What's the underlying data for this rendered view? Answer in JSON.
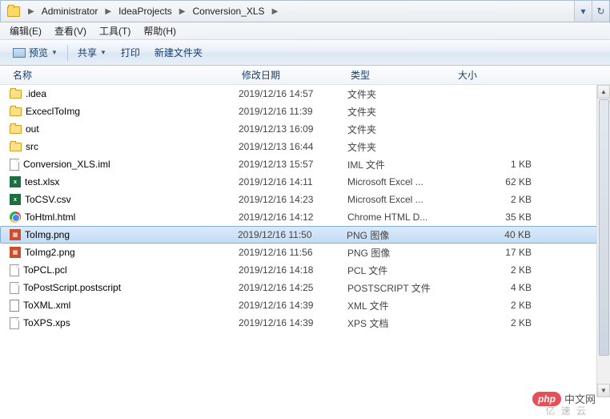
{
  "breadcrumb": [
    "Administrator",
    "IdeaProjects",
    "Conversion_XLS"
  ],
  "menu": {
    "edit": "编辑(E)",
    "view": "查看(V)",
    "tools": "工具(T)",
    "help": "帮助(H)"
  },
  "toolbar": {
    "preview": "预览",
    "share": "共享",
    "print": "打印",
    "newfolder": "新建文件夹"
  },
  "columns": {
    "name": "名称",
    "date": "修改日期",
    "type": "类型",
    "size": "大小"
  },
  "files": [
    {
      "icon": "folder",
      "name": ".idea",
      "date": "2019/12/16 14:57",
      "type": "文件夹",
      "size": ""
    },
    {
      "icon": "folder",
      "name": "ExceclToImg",
      "date": "2019/12/16 11:39",
      "type": "文件夹",
      "size": ""
    },
    {
      "icon": "folder",
      "name": "out",
      "date": "2019/12/13 16:09",
      "type": "文件夹",
      "size": ""
    },
    {
      "icon": "folder",
      "name": "src",
      "date": "2019/12/13 16:44",
      "type": "文件夹",
      "size": ""
    },
    {
      "icon": "file",
      "name": "Conversion_XLS.iml",
      "date": "2019/12/13 15:57",
      "type": "IML 文件",
      "size": "1 KB"
    },
    {
      "icon": "xls",
      "name": "test.xlsx",
      "date": "2019/12/16 14:11",
      "type": "Microsoft Excel ...",
      "size": "62 KB"
    },
    {
      "icon": "xls",
      "name": "ToCSV.csv",
      "date": "2019/12/16 14:23",
      "type": "Microsoft Excel ...",
      "size": "2 KB"
    },
    {
      "icon": "chrome",
      "name": "ToHtml.html",
      "date": "2019/12/16 14:12",
      "type": "Chrome HTML D...",
      "size": "35 KB"
    },
    {
      "icon": "png",
      "name": "ToImg.png",
      "date": "2019/12/16 11:50",
      "type": "PNG 图像",
      "size": "40 KB",
      "selected": true
    },
    {
      "icon": "png",
      "name": "ToImg2.png",
      "date": "2019/12/16 11:56",
      "type": "PNG 图像",
      "size": "17 KB"
    },
    {
      "icon": "file",
      "name": "ToPCL.pcl",
      "date": "2019/12/16 14:18",
      "type": "PCL 文件",
      "size": "2 KB"
    },
    {
      "icon": "file",
      "name": "ToPostScript.postscript",
      "date": "2019/12/16 14:25",
      "type": "POSTSCRIPT 文件",
      "size": "4 KB"
    },
    {
      "icon": "xml",
      "name": "ToXML.xml",
      "date": "2019/12/16 14:39",
      "type": "XML 文件",
      "size": "2 KB"
    },
    {
      "icon": "file",
      "name": "ToXPS.xps",
      "date": "2019/12/16 14:39",
      "type": "XPS 文档",
      "size": "2 KB"
    }
  ],
  "watermark": {
    "pill": "php",
    "text": "中文网",
    "sub": "亿 速 云"
  }
}
